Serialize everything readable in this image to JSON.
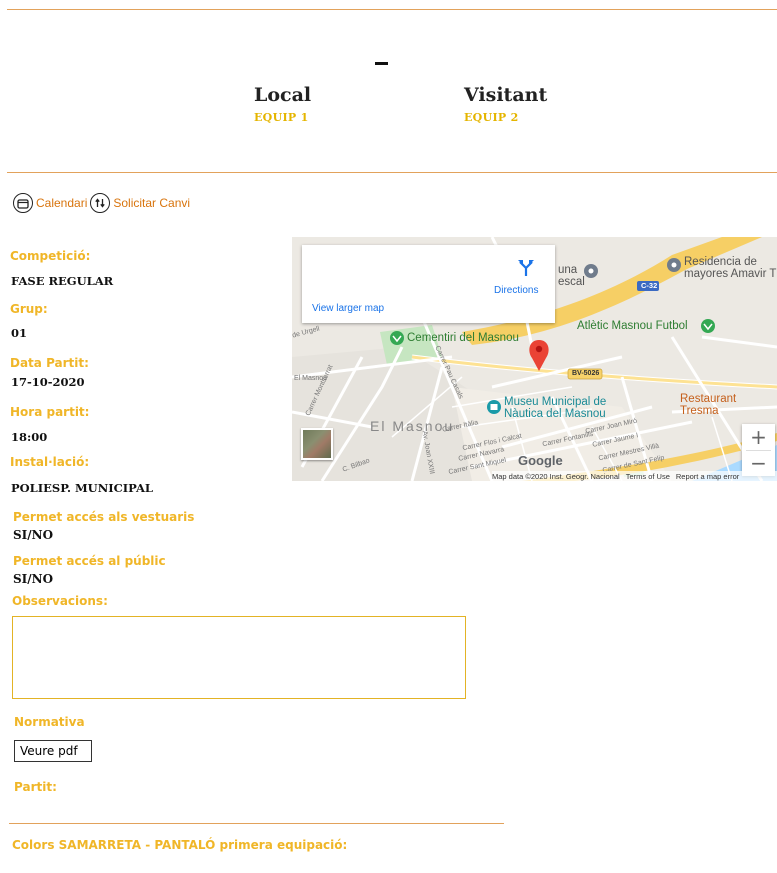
{
  "match": {
    "separator": "–",
    "local_label": "Local",
    "local_team": "EQUIP 1",
    "visitor_label": "Visitant",
    "visitor_team": "EQUIP 2"
  },
  "toolbar": {
    "calendar_label": "Calendari",
    "calendar_icon": "calendar-icon",
    "change_label": "Solicitar Canvi",
    "change_icon": "swap-icon"
  },
  "details": {
    "competition_label": "Competició:",
    "competition_value": "FASE REGULAR",
    "group_label": "Grup:",
    "group_value": "01",
    "date_label": "Data Partit:",
    "date_value": "17-10-2020",
    "time_label": "Hora partit:",
    "time_value": "18:00",
    "venue_label": "Instal·lació:",
    "venue_value": "POLIESP. MUNICIPAL",
    "locker_label": "Permet accés als vestuaris",
    "locker_value": "SI/NO",
    "public_label": "Permet accés al públic",
    "public_value": "SI/NO",
    "observations_label": "Observacions:",
    "normativa_label": "Normativa",
    "pdf_button": "Veure pdf",
    "partit_label": "Partit:",
    "colors_label": "Colors SAMARRETA - PANTALÓ primera equipació:"
  },
  "map": {
    "directions_label": "Directions",
    "larger_map_label": "View larger map",
    "zoom_in": "+",
    "zoom_out": "−",
    "places": {
      "cemetery": "Cementiri del Masnou",
      "football": "Atlètic Masnou Futbol",
      "residence_1": "Residencia de",
      "residence_2": "mayores Amavir T",
      "museum_1": "Museu Municipal de",
      "museum_2": "Nàutica del Masnou",
      "restaurant": "Restaurant Tresma",
      "town": "El Masnou",
      "una": "una",
      "escal": "escal",
      "road_c32": "C-32",
      "road_bv": "BV-5026"
    },
    "streets": {
      "joan_miro": "Carrer Joan Miró",
      "fontanills": "Carrer Fontanills",
      "flos": "Carrer Flos i Calcat",
      "navarra": "Carrer Navarra",
      "sant_miquel": "Carrer Sant Miquel",
      "jaume": "Carrer Jaume I",
      "mestres": "Carrer Mestres Villà",
      "sant_felip": "Carrer de Sant Felip",
      "pau_casals": "Carrer Pau Casals",
      "joan_xxiii": "Av. Joan XXIII",
      "montserrat": "Carrer Montserrat",
      "urgell": "de Urgell",
      "el_masnou_side": "El Masnou",
      "bilbao": "C. Bilbao",
      "italia": "Carrer Itàlia"
    },
    "google_logo": "Google",
    "footer_data": "Map data ©2020 Inst. Geogr. Nacional",
    "footer_terms": "Terms of Use",
    "footer_report": "Report a map error",
    "colors": {
      "pin": "#ea4335",
      "park": "#c6e6c1",
      "poi_green": "#34a853",
      "poi_blue": "#1a9aa8",
      "highway": "#f6cf65",
      "water": "#aadaff"
    }
  },
  "theme": {
    "accent": "#f0b628",
    "line": "#e2a25b",
    "link": "#d8740d"
  }
}
